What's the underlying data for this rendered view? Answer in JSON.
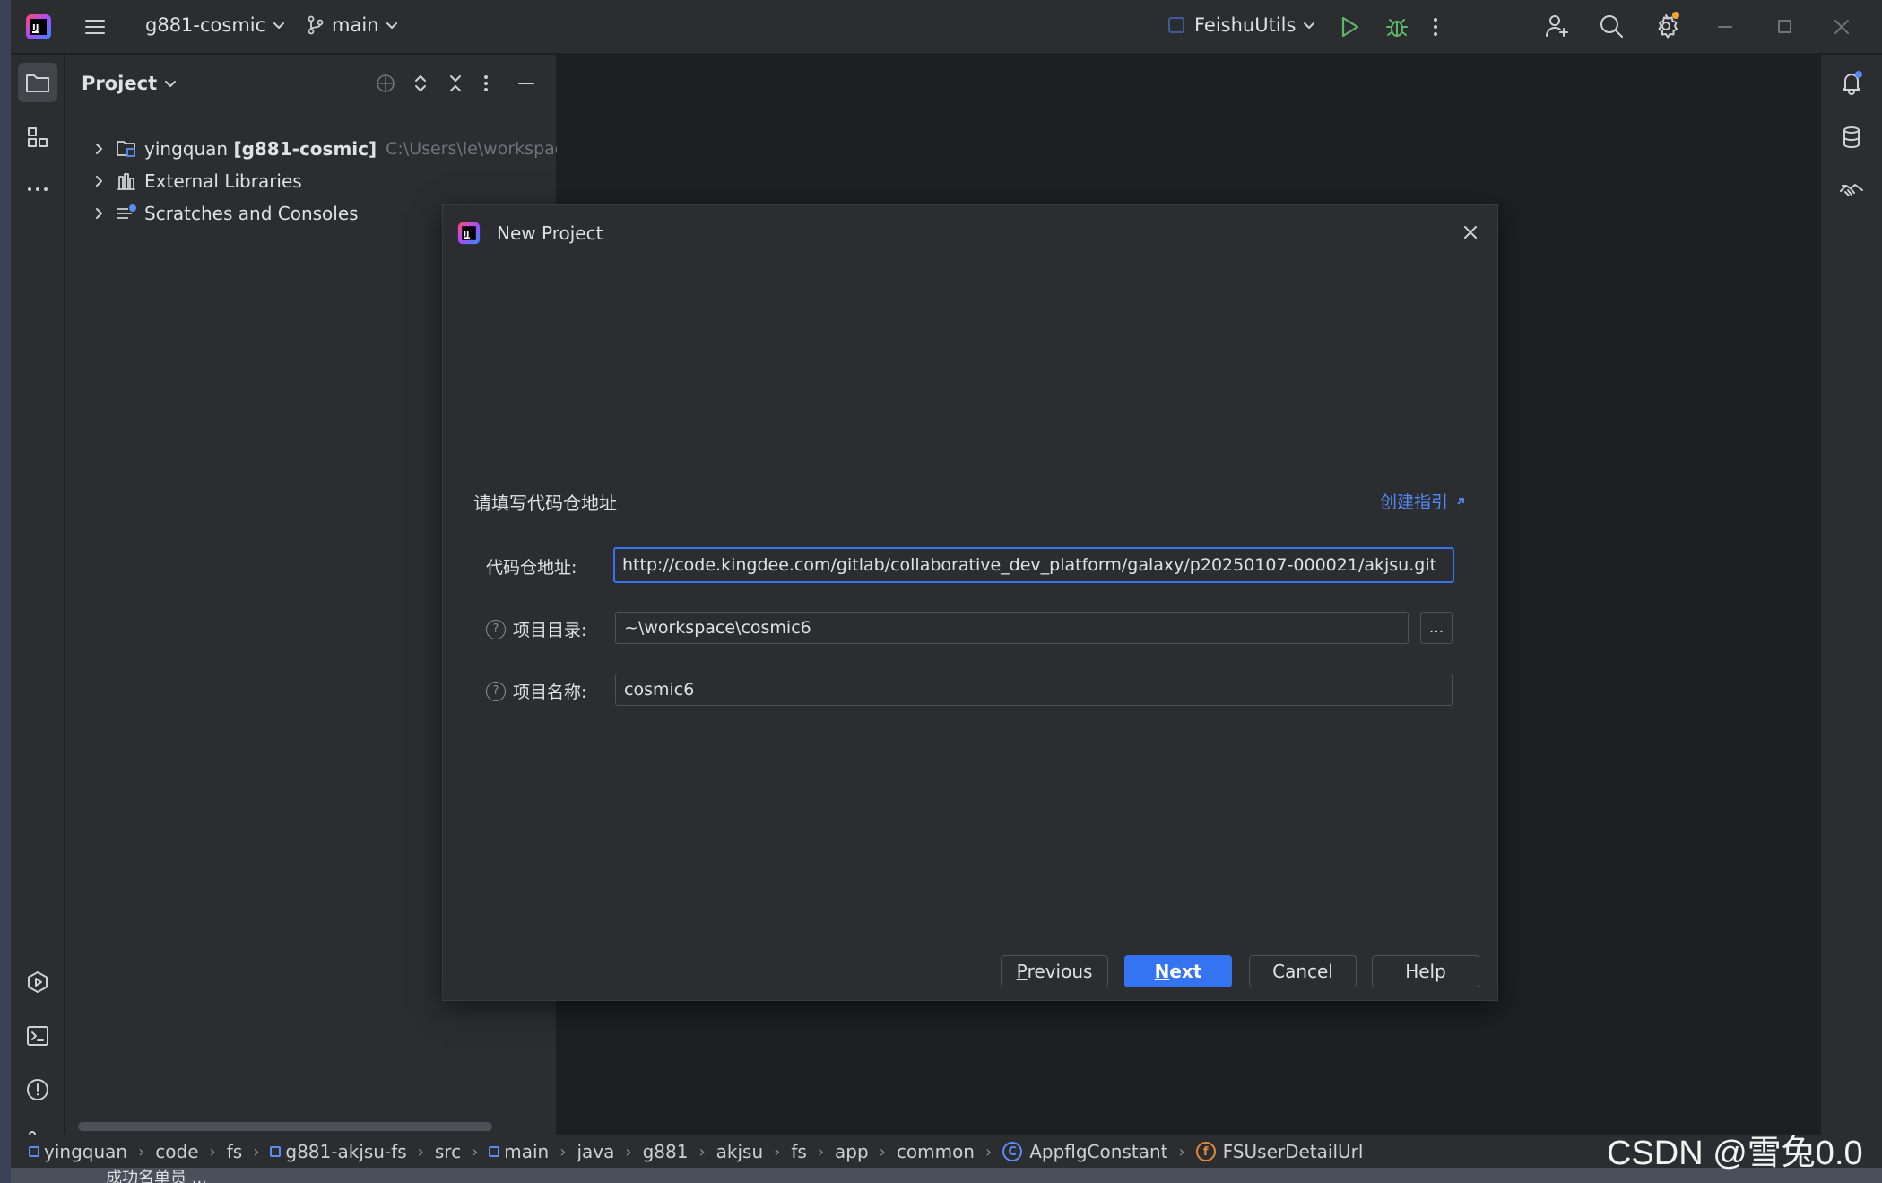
{
  "window": {
    "project_name": "g881-cosmic",
    "branch": "main",
    "run_config": "FeishuUtils"
  },
  "project_panel": {
    "title": "Project",
    "tree": [
      {
        "label": "yingquan",
        "bold_suffix": "[g881-cosmic]",
        "path": "C:\\Users\\le\\workspace\\yingquan"
      },
      {
        "label": "External Libraries"
      },
      {
        "label": "Scratches and Consoles"
      }
    ]
  },
  "dialog": {
    "title": "New Project",
    "section_title": "请填写代码仓地址",
    "guide_link": "创建指引",
    "fields": {
      "repo_label": "代码仓地址:",
      "repo_value": "http://code.kingdee.com/gitlab/collaborative_dev_platform/galaxy/p20250107-000021/akjsu.git",
      "dir_label": "项目目录:",
      "dir_value": "~\\workspace\\cosmic6",
      "name_label": "项目名称:",
      "name_value": "cosmic6",
      "browse": "..."
    },
    "buttons": {
      "previous_mn": "P",
      "previous_rest": "revious",
      "next_mn": "N",
      "next_rest": "ext",
      "cancel": "Cancel",
      "help": "Help"
    }
  },
  "breadcrumbs": [
    {
      "text": "yingquan",
      "icon": "module"
    },
    {
      "text": "code"
    },
    {
      "text": "fs"
    },
    {
      "text": "g881-akjsu-fs",
      "icon": "module"
    },
    {
      "text": "src"
    },
    {
      "text": "main",
      "icon": "module"
    },
    {
      "text": "java"
    },
    {
      "text": "g881"
    },
    {
      "text": "akjsu"
    },
    {
      "text": "fs"
    },
    {
      "text": "app"
    },
    {
      "text": "common"
    },
    {
      "text": "AppflgConstant",
      "icon": "class"
    },
    {
      "text": "FSUserDetailUrl",
      "icon": "field"
    }
  ],
  "watermark": "CSDN @雪兔0.0",
  "taskbar_text": "成功名单员 ...",
  "colors": {
    "accent": "#3574f0",
    "link": "#548af7",
    "run_green": "#5fb865",
    "badge_orange": "#f0a732"
  }
}
